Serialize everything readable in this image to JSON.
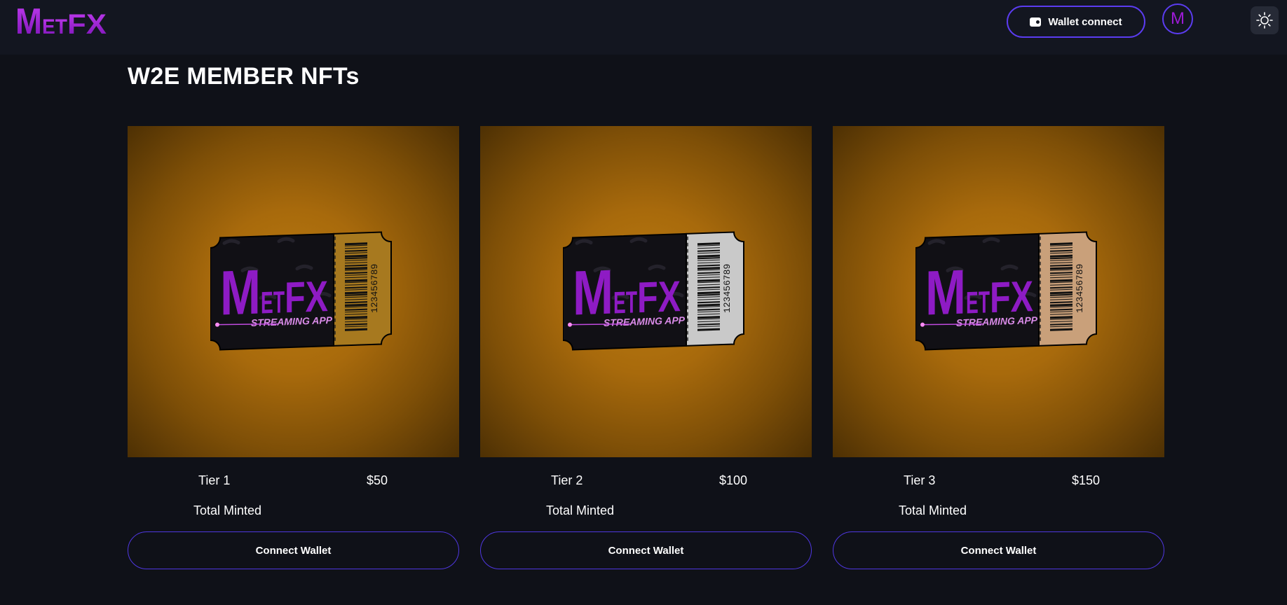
{
  "header": {
    "logo_text": "METFX",
    "wallet_button_label": "Wallet connect",
    "avatar_initial": "M"
  },
  "page": {
    "title": "W2E MEMBER NFTs"
  },
  "cards": [
    {
      "tier": "Tier 1",
      "price": "$50",
      "minted_label": "Total Minted",
      "button_label": "Connect Wallet",
      "stub_color": "#a7791f"
    },
    {
      "tier": "Tier 2",
      "price": "$100",
      "minted_label": "Total Minted",
      "button_label": "Connect Wallet",
      "stub_color": "#c9c9c9"
    },
    {
      "tier": "Tier 3",
      "price": "$150",
      "minted_label": "Total Minted",
      "button_label": "Connect Wallet",
      "stub_color": "#c9a07a"
    }
  ],
  "ticket": {
    "brand_text": "METFX",
    "subtitle": "STREAMING APP",
    "barcode_number": "123456789"
  },
  "colors": {
    "accent": "#5b3cf0",
    "brand_purple": "#9c1bd6",
    "background": "#0f1118",
    "header_background": "#131620"
  }
}
